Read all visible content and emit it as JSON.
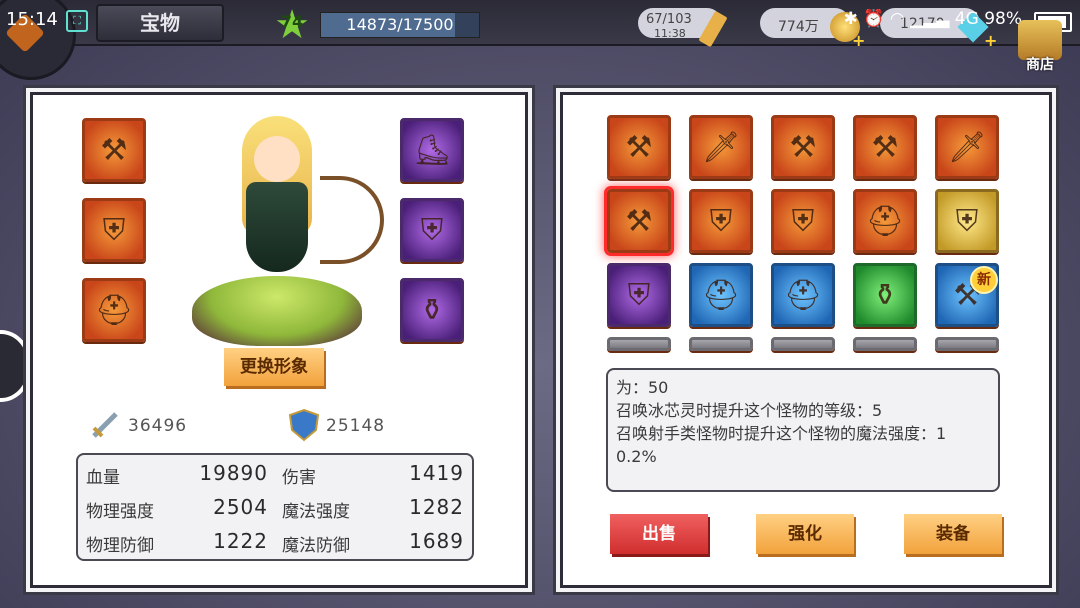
{
  "status": {
    "time": "15:14",
    "network": "4G",
    "battery": "98%"
  },
  "header": {
    "title": "宝物",
    "level": "74",
    "exp_text": "14873/17500",
    "exp_fraction": 0.85
  },
  "resources": [
    {
      "name": "stamina",
      "value": "67/103",
      "sub": "11:38",
      "icon": "pencil-icon"
    },
    {
      "name": "gold",
      "value": "774万",
      "icon": "coin-icon"
    },
    {
      "name": "gems",
      "value": "12170",
      "icon": "diamond-icon"
    }
  ],
  "shop_label": "商店",
  "hero_panel": {
    "change_look_label": "更换形象",
    "attack_power": "36496",
    "defense_power": "25148",
    "left_slots": [
      "axe",
      "armor",
      "helmet"
    ],
    "right_slots": [
      "boots",
      "chest",
      "bracer"
    ],
    "stats": [
      {
        "label": "血量",
        "value": "19890"
      },
      {
        "label": "伤害",
        "value": "1419"
      },
      {
        "label": "物理强度",
        "value": "2504"
      },
      {
        "label": "魔法强度",
        "value": "1282"
      },
      {
        "label": "物理防御",
        "value": "1222"
      },
      {
        "label": "魔法防御",
        "value": "1689"
      }
    ]
  },
  "inventory": {
    "rows": [
      [
        "red",
        "red",
        "red",
        "red",
        "red"
      ],
      [
        "red",
        "red",
        "red",
        "red",
        "gold"
      ],
      [
        "purple",
        "blue",
        "blue",
        "green",
        "blue"
      ]
    ],
    "new_badge": "新",
    "description": [
      "为：50",
      "召唤冰芯灵时提升这个怪物的等级：5",
      "召唤射手类怪物时提升这个怪物的魔法强度：1",
      "0.2%"
    ],
    "sell_label": "出售",
    "enhance_label": "强化",
    "equip_label": "装备"
  }
}
